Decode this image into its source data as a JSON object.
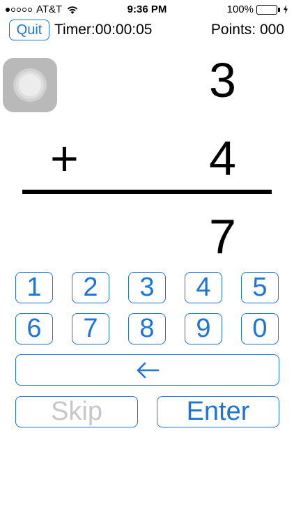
{
  "status_bar": {
    "carrier": "AT&T",
    "time": "9:36 PM",
    "battery": "100%",
    "battery_color": "#4cd964",
    "signal_icon": "signal-dots-icon",
    "wifi_icon": "wifi-icon",
    "charging_icon": "charging-bolt-icon"
  },
  "header": {
    "quit_label": "Quit",
    "timer": "Timer:00:00:05",
    "points": "Points: 000"
  },
  "problem": {
    "top_operand": "3",
    "operator": "+",
    "bottom_operand": "4",
    "answer": "7"
  },
  "keypad": {
    "row1": [
      "1",
      "2",
      "3",
      "4",
      "5"
    ],
    "row2": [
      "6",
      "7",
      "8",
      "9",
      "0"
    ],
    "backspace_icon": "arrow-left-icon",
    "skip_label": "Skip",
    "enter_label": "Enter"
  },
  "colors": {
    "accent": "#1c74d9",
    "disabled_text": "#c7c7c7"
  }
}
